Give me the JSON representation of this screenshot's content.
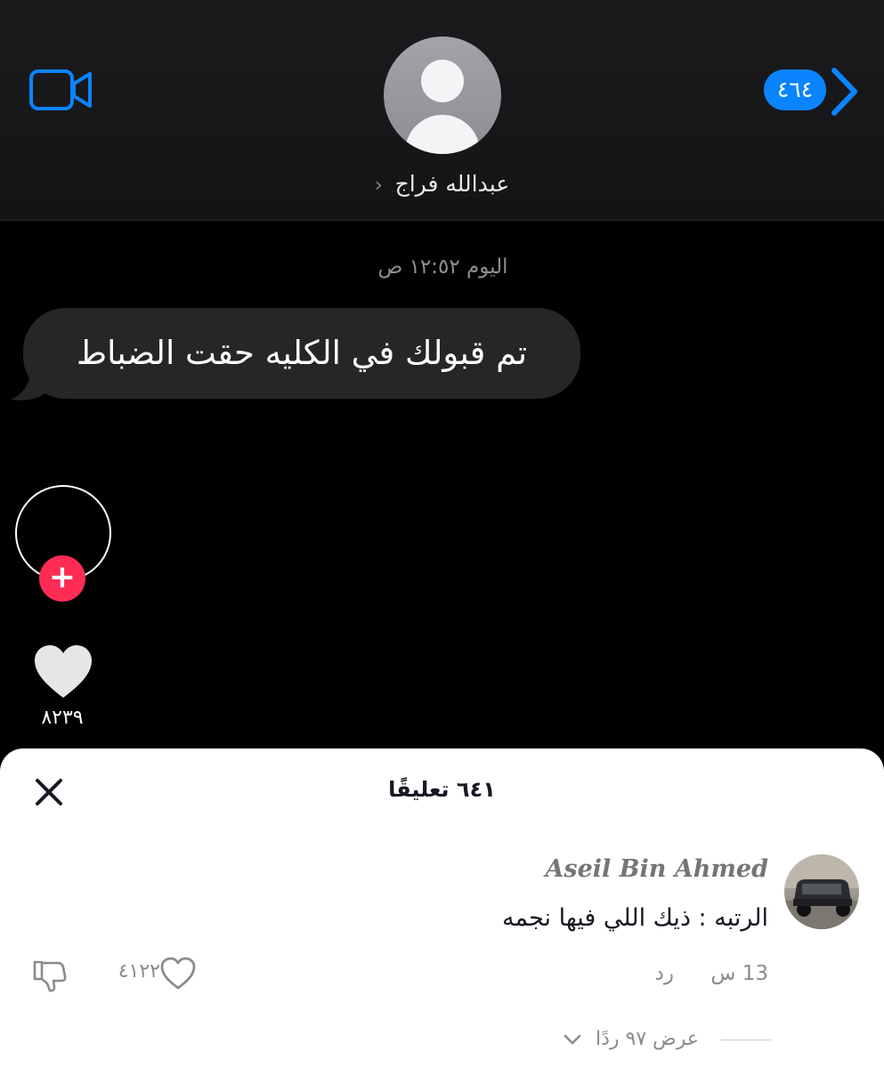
{
  "header": {
    "contact_name": "عبدالله فراج",
    "contact_chevron": "‹",
    "back_count": "٤٦٤",
    "icons": {
      "video": "video-camera-icon",
      "back": "chevron-right-icon",
      "avatar": "person-placeholder-icon"
    },
    "accent_color": "#0a84ff"
  },
  "chat": {
    "timestamp": "اليوم ١٢:٥٢ ص",
    "message": "تم قبولك في الكليه حقت الضباط"
  },
  "rail": {
    "follow_plus": "+",
    "likes": "٨٢٣٩",
    "icons": {
      "like": "heart-icon"
    },
    "follow_color": "#fe2c55"
  },
  "comments": {
    "title": "٦٤١ تعليقًا",
    "items": [
      {
        "username": "Aseil Bin Ahmed",
        "text": "الرتبه : ذيك اللي فيها نجمه",
        "time": "13 س",
        "reply_label": "رد",
        "likes": "٤١٢٢",
        "view_replies": "عرض ٩٧ ردًا"
      }
    ],
    "icons": {
      "close": "close-icon",
      "like": "heart-outline-icon",
      "dislike": "thumbs-down-icon",
      "expand": "chevron-down-icon"
    }
  }
}
